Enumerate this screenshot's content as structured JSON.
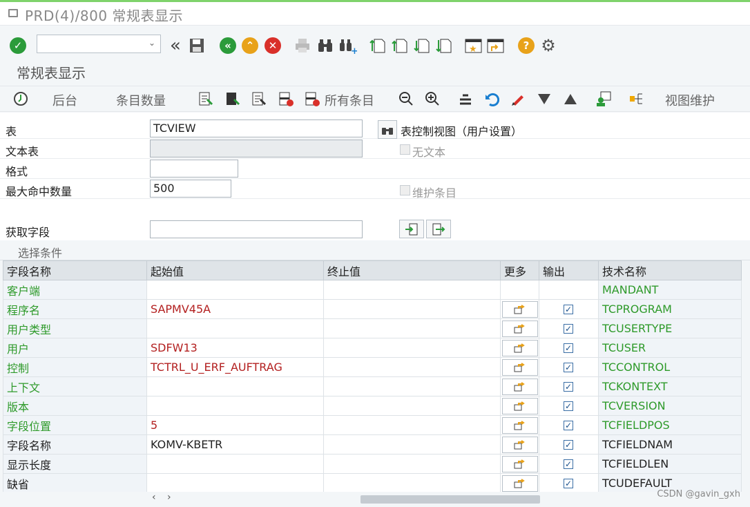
{
  "window": {
    "title": "PRD(4)/800 常规表显示"
  },
  "subtitle": "常规表显示",
  "app_toolbar": {
    "background_label": "后台",
    "entries_count_label": "条目数量",
    "all_entries_label": "所有条目",
    "maintain_view_label": "视图维护"
  },
  "form": {
    "table_label": "表",
    "table_value": "TCVIEW",
    "text_table_label": "文本表",
    "text_table_value": "",
    "format_label": "格式",
    "format_value": "",
    "max_hits_label": "最大命中数量",
    "max_hits_value": "500",
    "get_fields_label": "获取字段",
    "get_fields_value": "",
    "tc_view_label": "表控制视图（用户设置）",
    "no_text_label": "无文本",
    "maintain_entries_label": "维护条目"
  },
  "selection": {
    "title": "选择条件",
    "headers": [
      "字段名称",
      "起始值",
      "终止值",
      "更多",
      "输出",
      "技术名称"
    ],
    "rows": [
      {
        "name": "客户端",
        "from": "",
        "to": "",
        "more": false,
        "output": false,
        "tech": "MANDANT",
        "color": "green"
      },
      {
        "name": "程序名",
        "from": "SAPMV45A",
        "to": "",
        "more": true,
        "output": true,
        "tech": "TCPROGRAM",
        "color": "green"
      },
      {
        "name": "用户类型",
        "from": "",
        "to": "",
        "more": true,
        "output": true,
        "tech": "TCUSERTYPE",
        "color": "green"
      },
      {
        "name": "用户",
        "from": "SDFW13",
        "to": "",
        "more": true,
        "output": true,
        "tech": "TCUSER",
        "color": "green"
      },
      {
        "name": "控制",
        "from": "TCTRL_U_ERF_AUFTRAG",
        "to": "",
        "more": true,
        "output": true,
        "tech": "TCCONTROL",
        "color": "green"
      },
      {
        "name": "上下文",
        "from": "",
        "to": "",
        "more": true,
        "output": true,
        "tech": "TCKONTEXT",
        "color": "green"
      },
      {
        "name": "版本",
        "from": "",
        "to": "",
        "more": true,
        "output": true,
        "tech": "TCVERSION",
        "color": "green"
      },
      {
        "name": "字段位置",
        "from": "5",
        "to": "",
        "more": true,
        "output": true,
        "tech": "TCFIELDPOS",
        "color": "green"
      },
      {
        "name": "字段名称",
        "from": "KOMV-KBETR",
        "to": "",
        "more": true,
        "output": true,
        "tech": "TCFIELDNAM",
        "color": "black"
      },
      {
        "name": "显示长度",
        "from": "",
        "to": "",
        "more": true,
        "output": true,
        "tech": "TCFIELDLEN",
        "color": "black"
      },
      {
        "name": "缺省",
        "from": "",
        "to": "",
        "more": true,
        "output": true,
        "tech": "TCUDEFAULT",
        "color": "black"
      }
    ]
  },
  "watermark": "CSDN @gavin_gxh",
  "colors": {
    "green": "#2e9a2a",
    "red": "#b32020",
    "sap_blue": "#3a6ea5"
  }
}
